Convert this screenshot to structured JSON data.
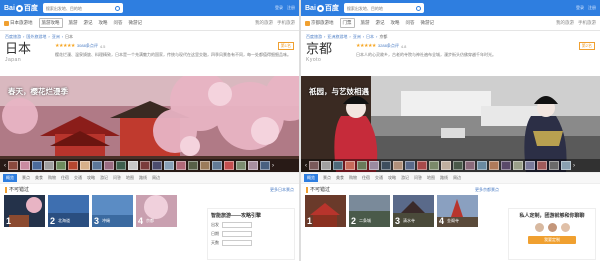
{
  "brand": {
    "name": "百度",
    "accent": "#2e7ee0",
    "warn": "#f0a030"
  },
  "panels": [
    {
      "search": {
        "value": "",
        "placeholder": "搜索出发地、目的地"
      },
      "toplinks": [
        "登录",
        "注册"
      ],
      "nav": {
        "items": [
          "日本旅游地",
          "旅游攻略",
          "旅游",
          "游记",
          "攻略",
          "问答",
          "微游记",
          "游记分享"
        ],
        "right": [
          "我的旅游",
          "手机旅游"
        ]
      },
      "breadcrumb": [
        "百度旅游",
        "国外旅游地",
        "亚洲",
        "日本"
      ],
      "title": {
        "cn": "日本",
        "en": "Japan"
      },
      "rating": {
        "stars": "★★★★★",
        "count": "3088条点评",
        "reviews": "4.5",
        "rank": "第1名"
      },
      "description": "樱花烂漫、温泉旖旎、料理精致，日本是一个充满魅力的国家，传统与现代在这里交融，四季风景各有不同，每一处都值得细细品味。",
      "hero": {
        "caption": "春天，樱花烂漫季",
        "colors": {
          "sky": "#c89aa0",
          "blossom": "#e8b4c4",
          "temple": "#b8342c"
        }
      },
      "tabs": [
        "概览",
        "景点",
        "美食",
        "购物",
        "住宿",
        "交通",
        "攻略",
        "游记",
        "问答",
        "地图",
        "路线",
        "周边"
      ],
      "section": {
        "title": "不可错过",
        "more": "更多日本景点"
      },
      "cards": [
        {
          "num": "1",
          "label": ""
        },
        {
          "num": "2",
          "label": "北海道"
        },
        {
          "num": "3",
          "label": "冲绳"
        },
        {
          "num": "4",
          "label": "京都"
        }
      ],
      "side": {
        "title": "智能旅游——攻略引擎",
        "rows": [
          "出发",
          "日期",
          "天数"
        ]
      }
    },
    {
      "search": {
        "value": "",
        "placeholder": "搜索出发地、目的地"
      },
      "toplinks": [
        "登录",
        "注册"
      ],
      "nav": {
        "items": [
          "京都旅游地",
          "门票",
          "旅游",
          "游记",
          "攻略",
          "问答",
          "微游记",
          "游记分享"
        ],
        "right": [
          "我的旅游",
          "手机旅游"
        ]
      },
      "breadcrumb": [
        "百度旅游",
        "亚洲旅游地",
        "亚洲",
        "日本",
        "京都"
      ],
      "title": {
        "cn": "京都",
        "en": "Kyoto"
      },
      "rating": {
        "stars": "★★★★★",
        "count": "3288条点评",
        "reviews": "4.8",
        "rank": "第2名"
      },
      "description": "日本人的心灵故乡，古老的寺院与神社遍布全城，漫步街头仿佛穿越千年时光。",
      "hero": {
        "caption": "祇园，与艺妓相遇",
        "colors": {
          "sky": "#e6e6e6",
          "road": "#6a6a6a",
          "kimono": "#c62b3a"
        }
      },
      "tabs": [
        "概览",
        "景点",
        "美食",
        "购物",
        "住宿",
        "交通",
        "攻略",
        "游记",
        "问答",
        "地图",
        "路线",
        "周边"
      ],
      "section": {
        "title": "不可错过",
        "more": "更多京都景点"
      },
      "cards": [
        {
          "num": "1",
          "label": ""
        },
        {
          "num": "2",
          "label": "二条城"
        },
        {
          "num": "3",
          "label": "清水寺"
        },
        {
          "num": "4",
          "label": "金阁寺"
        }
      ],
      "side": {
        "title": "私人定制，团游就够和你聊聊",
        "button": "我要定制"
      }
    }
  ]
}
